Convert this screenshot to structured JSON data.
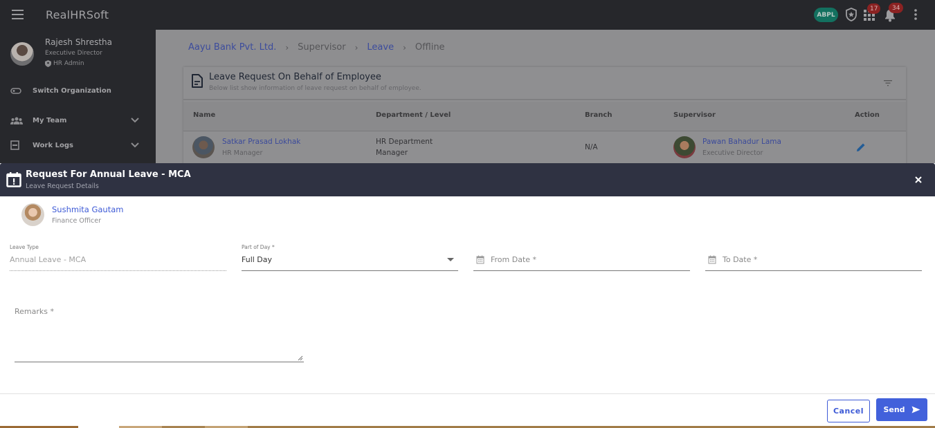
{
  "app": {
    "title": "RealHRSoft",
    "org_badge": "ABPL",
    "apps_badge_count": "17",
    "notifications_badge_count": "34"
  },
  "sidebar": {
    "user": {
      "name": "Rajesh Shrestha",
      "role": "Executive Director",
      "access": "HR Admin"
    },
    "items": [
      {
        "label": "Switch Organization",
        "icon": "toggle-icon",
        "expandable": false
      },
      {
        "label": "My Team",
        "icon": "team-icon",
        "expandable": true
      },
      {
        "label": "Work Logs",
        "icon": "work-logs-icon",
        "expandable": true
      }
    ]
  },
  "breadcrumb": [
    {
      "label": "Aayu Bank Pvt. Ltd.",
      "link": true
    },
    {
      "label": "Supervisor",
      "link": false
    },
    {
      "label": "Leave",
      "link": true
    },
    {
      "label": "Offline",
      "link": false
    }
  ],
  "breadcrumb_separator": "›",
  "card": {
    "title": "Leave Request On Behalf of Employee",
    "subtitle": "Below list show information of leave request on behalf of employee.",
    "columns": [
      "Name",
      "Department / Level",
      "Branch",
      "Supervisor",
      "Action"
    ],
    "rows": [
      {
        "name": "Satkar Prasad Lokhak",
        "name_sub": "HR Manager",
        "department": "HR Department",
        "level": "Manager",
        "branch": "N/A",
        "supervisor": "Pawan Bahadur Lama",
        "supervisor_sub": "Executive Director"
      }
    ]
  },
  "modal": {
    "title": "Request For Annual Leave - MCA",
    "subtitle": "Leave Request Details",
    "employee": {
      "name": "Sushmita Gautam",
      "role": "Finance Officer"
    },
    "fields": {
      "leave_type": {
        "label": "Leave Type",
        "value": "Annual Leave - MCA",
        "disabled": true
      },
      "part_of_day": {
        "label": "Part of Day *",
        "value": "Full Day"
      },
      "from_date": {
        "placeholder": "From Date *",
        "value": ""
      },
      "to_date": {
        "placeholder": "To Date *",
        "value": ""
      },
      "remarks": {
        "label": "Remarks *",
        "value": ""
      }
    },
    "buttons": {
      "cancel": "Cancel",
      "send": "Send"
    }
  },
  "colors": {
    "primary": "#4261db",
    "header_dark": "#2f3242",
    "org_badge": "#13705f",
    "notification_badge": "#8b2222"
  }
}
